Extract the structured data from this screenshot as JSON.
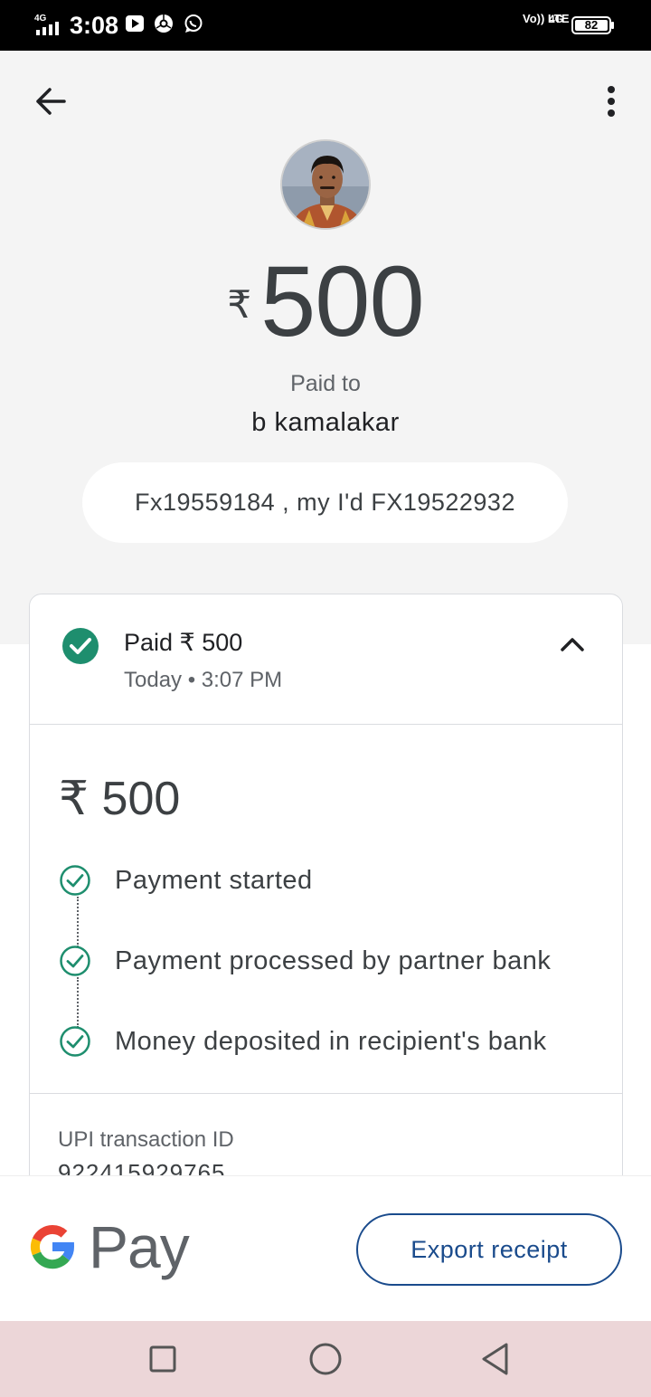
{
  "status_bar": {
    "time": "3:08",
    "network": "4G",
    "volte": "Vo)) LTE",
    "data_type": "4G",
    "battery": "82",
    "icons": [
      "signal-icon",
      "youtube-icon",
      "chrome-icon",
      "whatsapp-icon"
    ]
  },
  "header": {
    "back_icon": "arrow-back-icon",
    "more_icon": "more-vert-icon"
  },
  "payment": {
    "currency_symbol": "₹",
    "amount": "500",
    "paid_to_label": "Paid to",
    "payee_name": "b kamalakar",
    "note": "Fx19559184 , my I'd FX19522932"
  },
  "details": {
    "title": "Paid ₹ 500",
    "subtitle": "Today • 3:07 PM",
    "amount": "₹ 500",
    "steps": [
      {
        "label": "Payment started"
      },
      {
        "label": "Payment processed by partner bank"
      },
      {
        "label": "Money deposited in recipient's bank"
      }
    ],
    "upi_label": "UPI transaction ID",
    "upi_value": "922415929765"
  },
  "footer": {
    "brand": "Pay",
    "export_label": "Export receipt"
  },
  "colors": {
    "success_green": "#188038",
    "accent_blue": "#1a4b8c",
    "background_gray": "#f4f4f4",
    "nav_bar": "#ecd6d8"
  }
}
